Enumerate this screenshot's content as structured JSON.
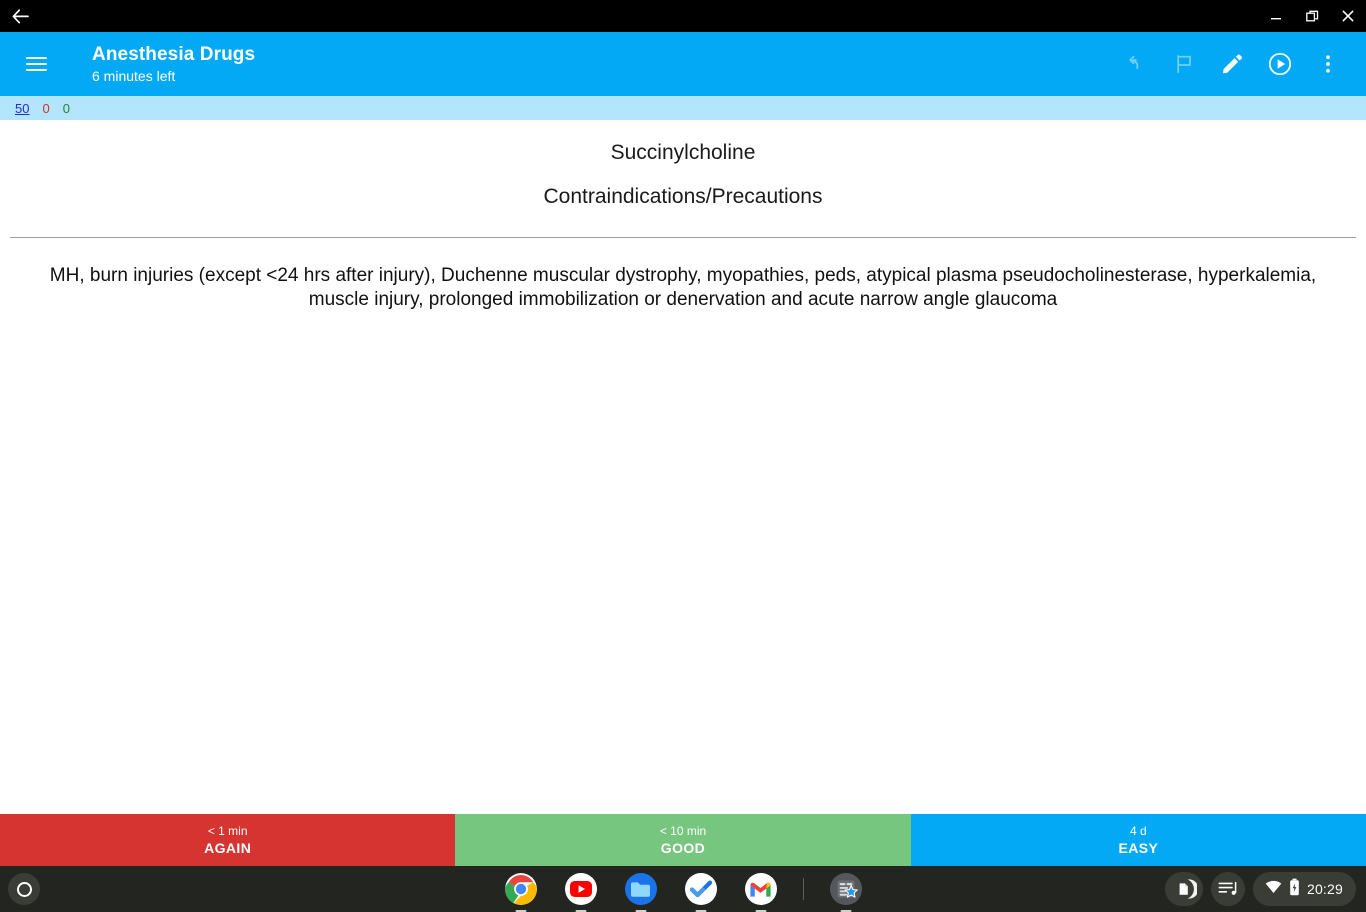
{
  "window": {
    "back_icon": "back-arrow-icon",
    "controls": [
      {
        "name": "minimize-button",
        "glyph": "–"
      },
      {
        "name": "restore-button",
        "glyph": "⧉"
      },
      {
        "name": "close-button",
        "glyph": "✕"
      }
    ]
  },
  "app_bar": {
    "menu_icon": "hamburger-menu-icon",
    "title": "Anesthesia Drugs",
    "subtitle": "6 minutes left",
    "accent_color": "#03A9F4",
    "actions": [
      {
        "name": "undo-button",
        "icon": "undo-icon",
        "enabled": false
      },
      {
        "name": "flag-button",
        "icon": "flag-icon",
        "enabled": false
      },
      {
        "name": "edit-button",
        "icon": "pencil-icon",
        "enabled": true
      },
      {
        "name": "play-button",
        "icon": "play-circle-icon",
        "enabled": true
      },
      {
        "name": "overflow-button",
        "icon": "more-vertical-icon",
        "enabled": true
      }
    ]
  },
  "counts": {
    "new": "50",
    "learning": "0",
    "review": "0",
    "new_color": "#2b2bd0",
    "learning_color": "#d32f2f",
    "review_color": "#2e7d32",
    "strip_color": "#B3E5FC"
  },
  "card": {
    "question": "Succinylcholine",
    "subject": "Contraindications/Precautions",
    "answer": "MH, burn injuries (except <24 hrs after injury), Duchenne muscular dystrophy, myopathies, peds, atypical plasma pseudocholinesterase, hyperkalemia, muscle injury, prolonged immobilization or denervation and acute narrow angle glaucoma"
  },
  "answer_buttons": [
    {
      "name": "again-button",
      "interval": "< 1 min",
      "label": "AGAIN",
      "color": "#d63430"
    },
    {
      "name": "good-button",
      "interval": "< 10 min",
      "label": "GOOD",
      "color": "#76c680"
    },
    {
      "name": "easy-button",
      "interval": "4 d",
      "label": "EASY",
      "color": "#03a9f4"
    }
  ],
  "taskbar": {
    "launcher": "launcher-circle-icon",
    "apps": [
      {
        "name": "chrome-icon",
        "label": "Chrome"
      },
      {
        "name": "youtube-icon",
        "label": "YouTube"
      },
      {
        "name": "files-icon",
        "label": "Files"
      },
      {
        "name": "tasks-icon",
        "label": "Tasks"
      },
      {
        "name": "gmail-icon",
        "label": "Gmail"
      },
      {
        "name": "ankidroid-icon",
        "label": "AnkiDroid"
      }
    ],
    "tray": {
      "file_icon": "document-icon",
      "music_icon": "music-playlist-icon",
      "wifi_icon": "wifi-icon",
      "battery_icon": "battery-icon",
      "clock": "20:29"
    }
  }
}
